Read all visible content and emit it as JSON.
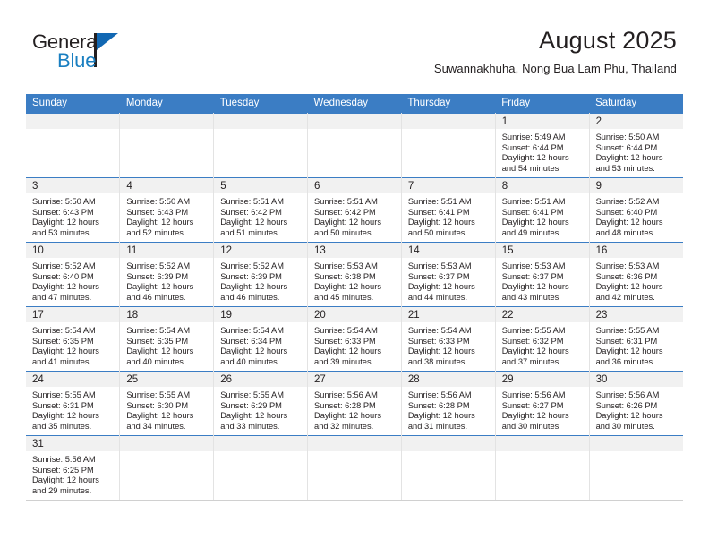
{
  "logo": {
    "line1": "General",
    "line2": "Blue",
    "triangle_color": "#1268b3",
    "text_color": "#231f20",
    "blue_text_color": "#1a7fc1"
  },
  "header": {
    "title": "August 2025",
    "subtitle": "Suwannakhuha, Nong Bua Lam Phu, Thailand"
  },
  "theme": {
    "header_bg": "#3b7dc4",
    "header_text": "#ffffff",
    "daybar_bg": "#f1f1f1",
    "cell_border": "#e3e3e3",
    "row_border": "#3b7dc4"
  },
  "calendar": {
    "weekday_headers": [
      "Sunday",
      "Monday",
      "Tuesday",
      "Wednesday",
      "Thursday",
      "Friday",
      "Saturday"
    ],
    "weeks": [
      [
        {
          "day": "",
          "empty": true
        },
        {
          "day": "",
          "empty": true
        },
        {
          "day": "",
          "empty": true
        },
        {
          "day": "",
          "empty": true
        },
        {
          "day": "",
          "empty": true
        },
        {
          "day": "1",
          "sunrise": "Sunrise: 5:49 AM",
          "sunset": "Sunset: 6:44 PM",
          "daylight1": "Daylight: 12 hours",
          "daylight2": "and 54 minutes."
        },
        {
          "day": "2",
          "sunrise": "Sunrise: 5:50 AM",
          "sunset": "Sunset: 6:44 PM",
          "daylight1": "Daylight: 12 hours",
          "daylight2": "and 53 minutes."
        }
      ],
      [
        {
          "day": "3",
          "sunrise": "Sunrise: 5:50 AM",
          "sunset": "Sunset: 6:43 PM",
          "daylight1": "Daylight: 12 hours",
          "daylight2": "and 53 minutes."
        },
        {
          "day": "4",
          "sunrise": "Sunrise: 5:50 AM",
          "sunset": "Sunset: 6:43 PM",
          "daylight1": "Daylight: 12 hours",
          "daylight2": "and 52 minutes."
        },
        {
          "day": "5",
          "sunrise": "Sunrise: 5:51 AM",
          "sunset": "Sunset: 6:42 PM",
          "daylight1": "Daylight: 12 hours",
          "daylight2": "and 51 minutes."
        },
        {
          "day": "6",
          "sunrise": "Sunrise: 5:51 AM",
          "sunset": "Sunset: 6:42 PM",
          "daylight1": "Daylight: 12 hours",
          "daylight2": "and 50 minutes."
        },
        {
          "day": "7",
          "sunrise": "Sunrise: 5:51 AM",
          "sunset": "Sunset: 6:41 PM",
          "daylight1": "Daylight: 12 hours",
          "daylight2": "and 50 minutes."
        },
        {
          "day": "8",
          "sunrise": "Sunrise: 5:51 AM",
          "sunset": "Sunset: 6:41 PM",
          "daylight1": "Daylight: 12 hours",
          "daylight2": "and 49 minutes."
        },
        {
          "day": "9",
          "sunrise": "Sunrise: 5:52 AM",
          "sunset": "Sunset: 6:40 PM",
          "daylight1": "Daylight: 12 hours",
          "daylight2": "and 48 minutes."
        }
      ],
      [
        {
          "day": "10",
          "sunrise": "Sunrise: 5:52 AM",
          "sunset": "Sunset: 6:40 PM",
          "daylight1": "Daylight: 12 hours",
          "daylight2": "and 47 minutes."
        },
        {
          "day": "11",
          "sunrise": "Sunrise: 5:52 AM",
          "sunset": "Sunset: 6:39 PM",
          "daylight1": "Daylight: 12 hours",
          "daylight2": "and 46 minutes."
        },
        {
          "day": "12",
          "sunrise": "Sunrise: 5:52 AM",
          "sunset": "Sunset: 6:39 PM",
          "daylight1": "Daylight: 12 hours",
          "daylight2": "and 46 minutes."
        },
        {
          "day": "13",
          "sunrise": "Sunrise: 5:53 AM",
          "sunset": "Sunset: 6:38 PM",
          "daylight1": "Daylight: 12 hours",
          "daylight2": "and 45 minutes."
        },
        {
          "day": "14",
          "sunrise": "Sunrise: 5:53 AM",
          "sunset": "Sunset: 6:37 PM",
          "daylight1": "Daylight: 12 hours",
          "daylight2": "and 44 minutes."
        },
        {
          "day": "15",
          "sunrise": "Sunrise: 5:53 AM",
          "sunset": "Sunset: 6:37 PM",
          "daylight1": "Daylight: 12 hours",
          "daylight2": "and 43 minutes."
        },
        {
          "day": "16",
          "sunrise": "Sunrise: 5:53 AM",
          "sunset": "Sunset: 6:36 PM",
          "daylight1": "Daylight: 12 hours",
          "daylight2": "and 42 minutes."
        }
      ],
      [
        {
          "day": "17",
          "sunrise": "Sunrise: 5:54 AM",
          "sunset": "Sunset: 6:35 PM",
          "daylight1": "Daylight: 12 hours",
          "daylight2": "and 41 minutes."
        },
        {
          "day": "18",
          "sunrise": "Sunrise: 5:54 AM",
          "sunset": "Sunset: 6:35 PM",
          "daylight1": "Daylight: 12 hours",
          "daylight2": "and 40 minutes."
        },
        {
          "day": "19",
          "sunrise": "Sunrise: 5:54 AM",
          "sunset": "Sunset: 6:34 PM",
          "daylight1": "Daylight: 12 hours",
          "daylight2": "and 40 minutes."
        },
        {
          "day": "20",
          "sunrise": "Sunrise: 5:54 AM",
          "sunset": "Sunset: 6:33 PM",
          "daylight1": "Daylight: 12 hours",
          "daylight2": "and 39 minutes."
        },
        {
          "day": "21",
          "sunrise": "Sunrise: 5:54 AM",
          "sunset": "Sunset: 6:33 PM",
          "daylight1": "Daylight: 12 hours",
          "daylight2": "and 38 minutes."
        },
        {
          "day": "22",
          "sunrise": "Sunrise: 5:55 AM",
          "sunset": "Sunset: 6:32 PM",
          "daylight1": "Daylight: 12 hours",
          "daylight2": "and 37 minutes."
        },
        {
          "day": "23",
          "sunrise": "Sunrise: 5:55 AM",
          "sunset": "Sunset: 6:31 PM",
          "daylight1": "Daylight: 12 hours",
          "daylight2": "and 36 minutes."
        }
      ],
      [
        {
          "day": "24",
          "sunrise": "Sunrise: 5:55 AM",
          "sunset": "Sunset: 6:31 PM",
          "daylight1": "Daylight: 12 hours",
          "daylight2": "and 35 minutes."
        },
        {
          "day": "25",
          "sunrise": "Sunrise: 5:55 AM",
          "sunset": "Sunset: 6:30 PM",
          "daylight1": "Daylight: 12 hours",
          "daylight2": "and 34 minutes."
        },
        {
          "day": "26",
          "sunrise": "Sunrise: 5:55 AM",
          "sunset": "Sunset: 6:29 PM",
          "daylight1": "Daylight: 12 hours",
          "daylight2": "and 33 minutes."
        },
        {
          "day": "27",
          "sunrise": "Sunrise: 5:56 AM",
          "sunset": "Sunset: 6:28 PM",
          "daylight1": "Daylight: 12 hours",
          "daylight2": "and 32 minutes."
        },
        {
          "day": "28",
          "sunrise": "Sunrise: 5:56 AM",
          "sunset": "Sunset: 6:28 PM",
          "daylight1": "Daylight: 12 hours",
          "daylight2": "and 31 minutes."
        },
        {
          "day": "29",
          "sunrise": "Sunrise: 5:56 AM",
          "sunset": "Sunset: 6:27 PM",
          "daylight1": "Daylight: 12 hours",
          "daylight2": "and 30 minutes."
        },
        {
          "day": "30",
          "sunrise": "Sunrise: 5:56 AM",
          "sunset": "Sunset: 6:26 PM",
          "daylight1": "Daylight: 12 hours",
          "daylight2": "and 30 minutes."
        }
      ],
      [
        {
          "day": "31",
          "sunrise": "Sunrise: 5:56 AM",
          "sunset": "Sunset: 6:25 PM",
          "daylight1": "Daylight: 12 hours",
          "daylight2": "and 29 minutes."
        },
        {
          "day": "",
          "empty": true
        },
        {
          "day": "",
          "empty": true
        },
        {
          "day": "",
          "empty": true
        },
        {
          "day": "",
          "empty": true
        },
        {
          "day": "",
          "empty": true
        },
        {
          "day": "",
          "empty": true
        }
      ]
    ]
  }
}
